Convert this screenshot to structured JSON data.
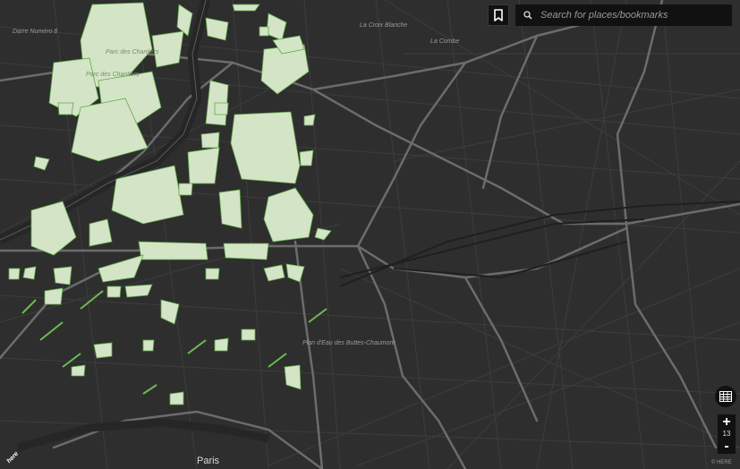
{
  "search": {
    "placeholder": "Search for places/bookmarks"
  },
  "map": {
    "zoom_level": "13",
    "labels": {
      "darre_numero_8": "Darre Numéro 8",
      "la_croix_blanche": "La Croix Blanche",
      "la_combe": "La Combe",
      "parc_des_chantiers": "Parc des Chantiers",
      "parc_des_chantiers_2": "Parc des Chantiers",
      "plan_deau": "Plan d'Eau des Buttes-Chaumont",
      "paris": "Paris"
    },
    "colors": {
      "background": "#2e2e2e",
      "roads": "#5a5a5a",
      "major_roads": "#707070",
      "parks": "#d4e4c6",
      "park_edges": "#5fa94a",
      "rail": "#1e1e1e"
    }
  },
  "controls": {
    "zoom_in": "+",
    "zoom_out": "-"
  },
  "logo": "here",
  "copyright": "© HERE",
  "icons": {
    "bookmark": "bookmark-icon",
    "search": "search-icon",
    "table": "table-icon"
  }
}
